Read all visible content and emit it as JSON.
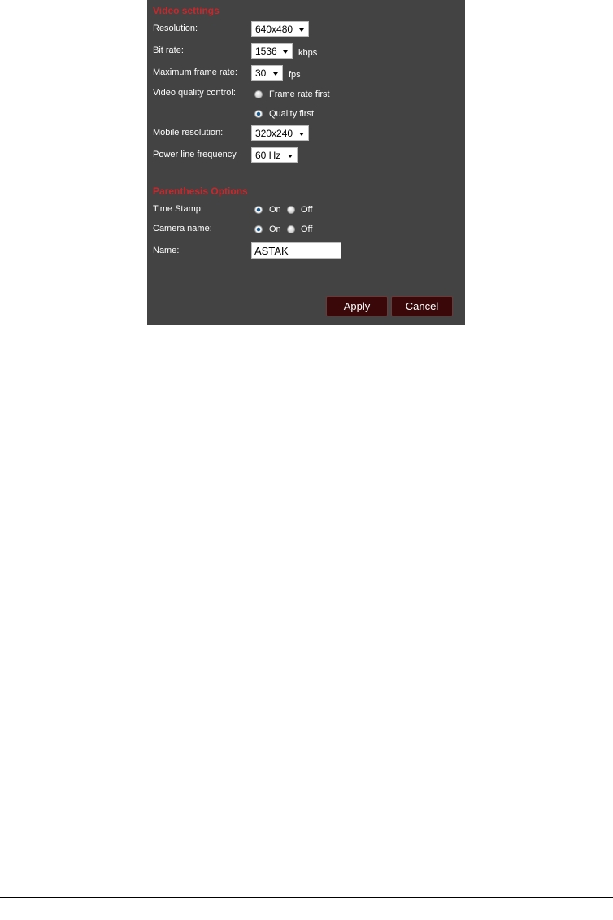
{
  "video": {
    "heading": "Video settings",
    "resolution": {
      "label": "Resolution:",
      "value": "640x480"
    },
    "bitrate": {
      "label": "Bit rate:",
      "value": "1536",
      "unit": "kbps"
    },
    "framerate": {
      "label": "Maximum frame rate:",
      "value": "30",
      "unit": "fps"
    },
    "quality": {
      "label": "Video quality control:",
      "opt1": "Frame rate first",
      "opt2": "Quality first",
      "selected": "Quality first"
    },
    "mobile": {
      "label": "Mobile resolution:",
      "value": "320x240"
    },
    "power": {
      "label": "Power line frequency",
      "value": "60 Hz"
    }
  },
  "paren": {
    "heading": "Parenthesis Options",
    "timestamp": {
      "label": "Time Stamp:",
      "on": "On",
      "off": "Off",
      "selected": "On"
    },
    "camera": {
      "label": "Camera name:",
      "on": "On",
      "off": "Off",
      "selected": "On"
    },
    "name": {
      "label": "Name:",
      "value": "ASTAK"
    }
  },
  "buttons": {
    "apply": "Apply",
    "cancel": "Cancel"
  }
}
